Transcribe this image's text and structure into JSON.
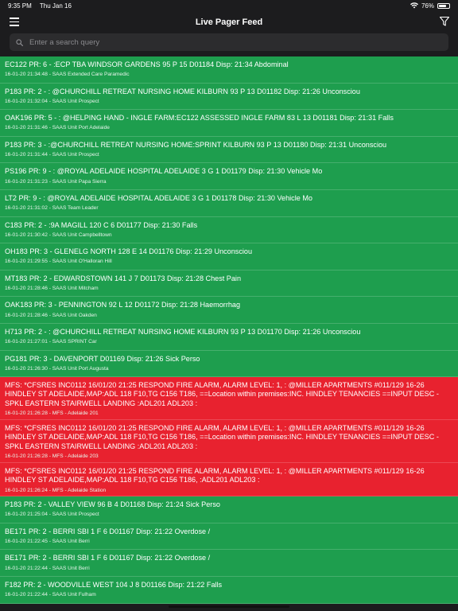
{
  "status_bar": {
    "time": "9:35 PM",
    "date": "Thu Jan 16",
    "battery": "76%",
    "battery_level": 0.76
  },
  "nav": {
    "title": "Live Pager Feed",
    "menu_icon": "hamburger-menu-icon",
    "filter_icon": "filter-funnel-icon"
  },
  "search": {
    "placeholder": "Enter a search query",
    "value": ""
  },
  "colors": {
    "ambulance": "#1e9e4e",
    "fire": "#e8222f",
    "background": "#1c1c1e"
  },
  "feed": [
    {
      "type": "green",
      "message": "EC122 PR: 6 - :ECP TBA WINDSOR GARDENS 95 P 15 D01184 Disp: 21:34 Abdominal",
      "meta": "16-01-20 21:34:48 - SAAS Extended Care Paramedic"
    },
    {
      "type": "green",
      "message": "P183 PR: 2 - : @CHURCHILL RETREAT NURSING HOME KILBURN 93 P 13 D01182 Disp: 21:26 Unconsciou",
      "meta": "16-01-20 21:32:04 - SAAS Unit Prospect"
    },
    {
      "type": "green",
      "message": "OAK196 PR: 5 - : @HELPING HAND - INGLE FARM:EC122 ASSESSED INGLE FARM 83 L 13 D01181 Disp: 21:31 Falls",
      "meta": "16-01-20 21:31:46 - SAAS Unit Port Adelaide"
    },
    {
      "type": "green",
      "message": "P183 PR: 3 - :@CHURCHILL RETREAT NURSING HOME:SPRINT KILBURN 93 P 13 D01180 Disp: 21:31 Unconsciou",
      "meta": "16-01-20 21:31:44 - SAAS Unit Prospect"
    },
    {
      "type": "green",
      "message": "PS196 PR: 9 - : @ROYAL ADELAIDE HOSPITAL ADELAIDE 3 G 1 D01179 Disp: 21:30 Vehicle Mo",
      "meta": "16-01-20 21:31:23 - SAAS Unit Papa Sierra"
    },
    {
      "type": "green",
      "message": "LT2 PR: 9 - : @ROYAL ADELAIDE HOSPITAL ADELAIDE 3 G 1 D01178 Disp: 21:30 Vehicle Mo",
      "meta": "16-01-20 21:31:02 - SAAS Team Leader"
    },
    {
      "type": "green",
      "message": "C183 PR: 2 - :9A MAGILL 120 C 6 D01177 Disp: 21:30 Falls",
      "meta": "16-01-20 21:30:42 - SAAS Unit Campbelltown"
    },
    {
      "type": "green",
      "message": "OH183 PR: 3 - GLENELG NORTH 128 E 14 D01176 Disp: 21:29 Unconsciou",
      "meta": "16-01-20 21:29:55 - SAAS Unit O'Halloran Hill"
    },
    {
      "type": "green",
      "message": "MT183 PR: 2 - EDWARDSTOWN 141 J 7 D01173 Disp: 21:28 Chest Pain",
      "meta": "16-01-20 21:28:46 - SAAS Unit Mitcham"
    },
    {
      "type": "green",
      "message": "OAK183 PR: 3 - PENNINGTON 92 L 12 D01172 Disp: 21:28 Haemorrhag",
      "meta": "16-01-20 21:28:46 - SAAS Unit Oakden"
    },
    {
      "type": "green",
      "message": "H713 PR: 2 - : @CHURCHILL RETREAT NURSING HOME KILBURN 93 P 13 D01170 Disp: 21:26 Unconsciou",
      "meta": "16-01-20 21:27:01 - SAAS SPRINT Car"
    },
    {
      "type": "green",
      "message": "PG181 PR: 3 - DAVENPORT D01169 Disp: 21:26 Sick Perso",
      "meta": "16-01-20 21:26:30 - SAAS Unit Port Augusta"
    },
    {
      "type": "red",
      "message": "MFS: *CFSRES INC0112 16/01/20 21:25 RESPOND FIRE ALARM, ALARM LEVEL: 1, : @MILLER APARTMENTS #011/129 16-26 HINDLEY ST ADELAIDE,MAP:ADL 118 F10,TG C156 T186, ==Location within premises:INC. HINDLEY TENANCIES ==INPUT DESC -SPKL EASTERN STAIRWELL LANDING :ADL201 ADL203 :",
      "meta": "16-01-20 21:26:28 - MFS - Adelaide 201"
    },
    {
      "type": "red",
      "message": "MFS: *CFSRES INC0112 16/01/20 21:25 RESPOND FIRE ALARM, ALARM LEVEL: 1, : @MILLER APARTMENTS #011/129 16-26 HINDLEY ST ADELAIDE,MAP:ADL 118 F10,TG C156 T186, ==Location within premises:INC. HINDLEY TENANCIES ==INPUT DESC -SPKL EASTERN STAIRWELL LANDING :ADL201 ADL203 :",
      "meta": "16-01-20 21:26:28 - MFS - Adelaide 203"
    },
    {
      "type": "red",
      "message": "MFS: *CFSRES INC0112 16/01/20 21:25 RESPOND FIRE ALARM, ALARM LEVEL: 1, : @MILLER APARTMENTS #011/129 16-26 HINDLEY ST ADELAIDE,MAP:ADL 118 F10,TG C156 T186, :ADL201 ADL203 :",
      "meta": "16-01-20 21:26:24 - MFS - Adelaide Station"
    },
    {
      "type": "green",
      "message": "P183 PR: 2 - VALLEY VIEW 96 B 4 D01168 Disp: 21:24 Sick Perso",
      "meta": "16-01-20 21:25:04 - SAAS Unit Prospect"
    },
    {
      "type": "green",
      "message": "BE171 PR: 2 - BERRI SBI 1 F 6 D01167 Disp: 21:22 Overdose /",
      "meta": "16-01-20 21:22:45 - SAAS Unit Berri"
    },
    {
      "type": "green",
      "message": "BE171 PR: 2 - BERRI SBI 1 F 6 D01167 Disp: 21:22 Overdose /",
      "meta": "16-01-20 21:22:44 - SAAS Unit Berri"
    },
    {
      "type": "green",
      "message": "F182 PR: 2 - WOODVILLE WEST 104 J 8 D01166 Disp: 21:22 Falls",
      "meta": "16-01-20 21:22:44 - SAAS Unit Fulham"
    }
  ]
}
